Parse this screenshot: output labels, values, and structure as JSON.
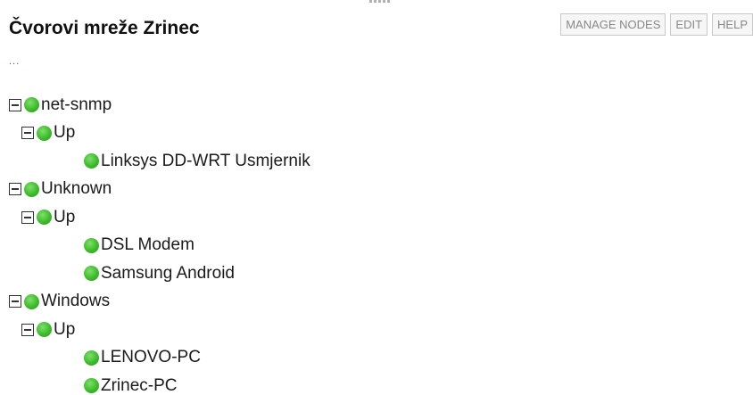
{
  "title": "Čvorovi mreže Zrinec",
  "more": "...",
  "toolbar": {
    "manage_label": "MANAGE NODES",
    "edit_label": "EDIT",
    "help_label": "HELP"
  },
  "colors": {
    "status_up": "#3dbb2b",
    "link_purple": "#7a3aa3"
  },
  "tree": [
    {
      "label": "net-snmp",
      "children": [
        {
          "label": "Up",
          "children": [
            {
              "label": "Linksys DD-WRT Usmjernik"
            }
          ]
        }
      ]
    },
    {
      "label": "Unknown",
      "children": [
        {
          "label": "Up",
          "children": [
            {
              "label": "DSL Modem"
            },
            {
              "label": "Samsung Android"
            }
          ]
        }
      ]
    },
    {
      "label": "Windows",
      "children": [
        {
          "label": "Up",
          "children": [
            {
              "label": "LENOVO-PC"
            },
            {
              "label": "Zrinec-PC"
            }
          ]
        }
      ]
    }
  ]
}
